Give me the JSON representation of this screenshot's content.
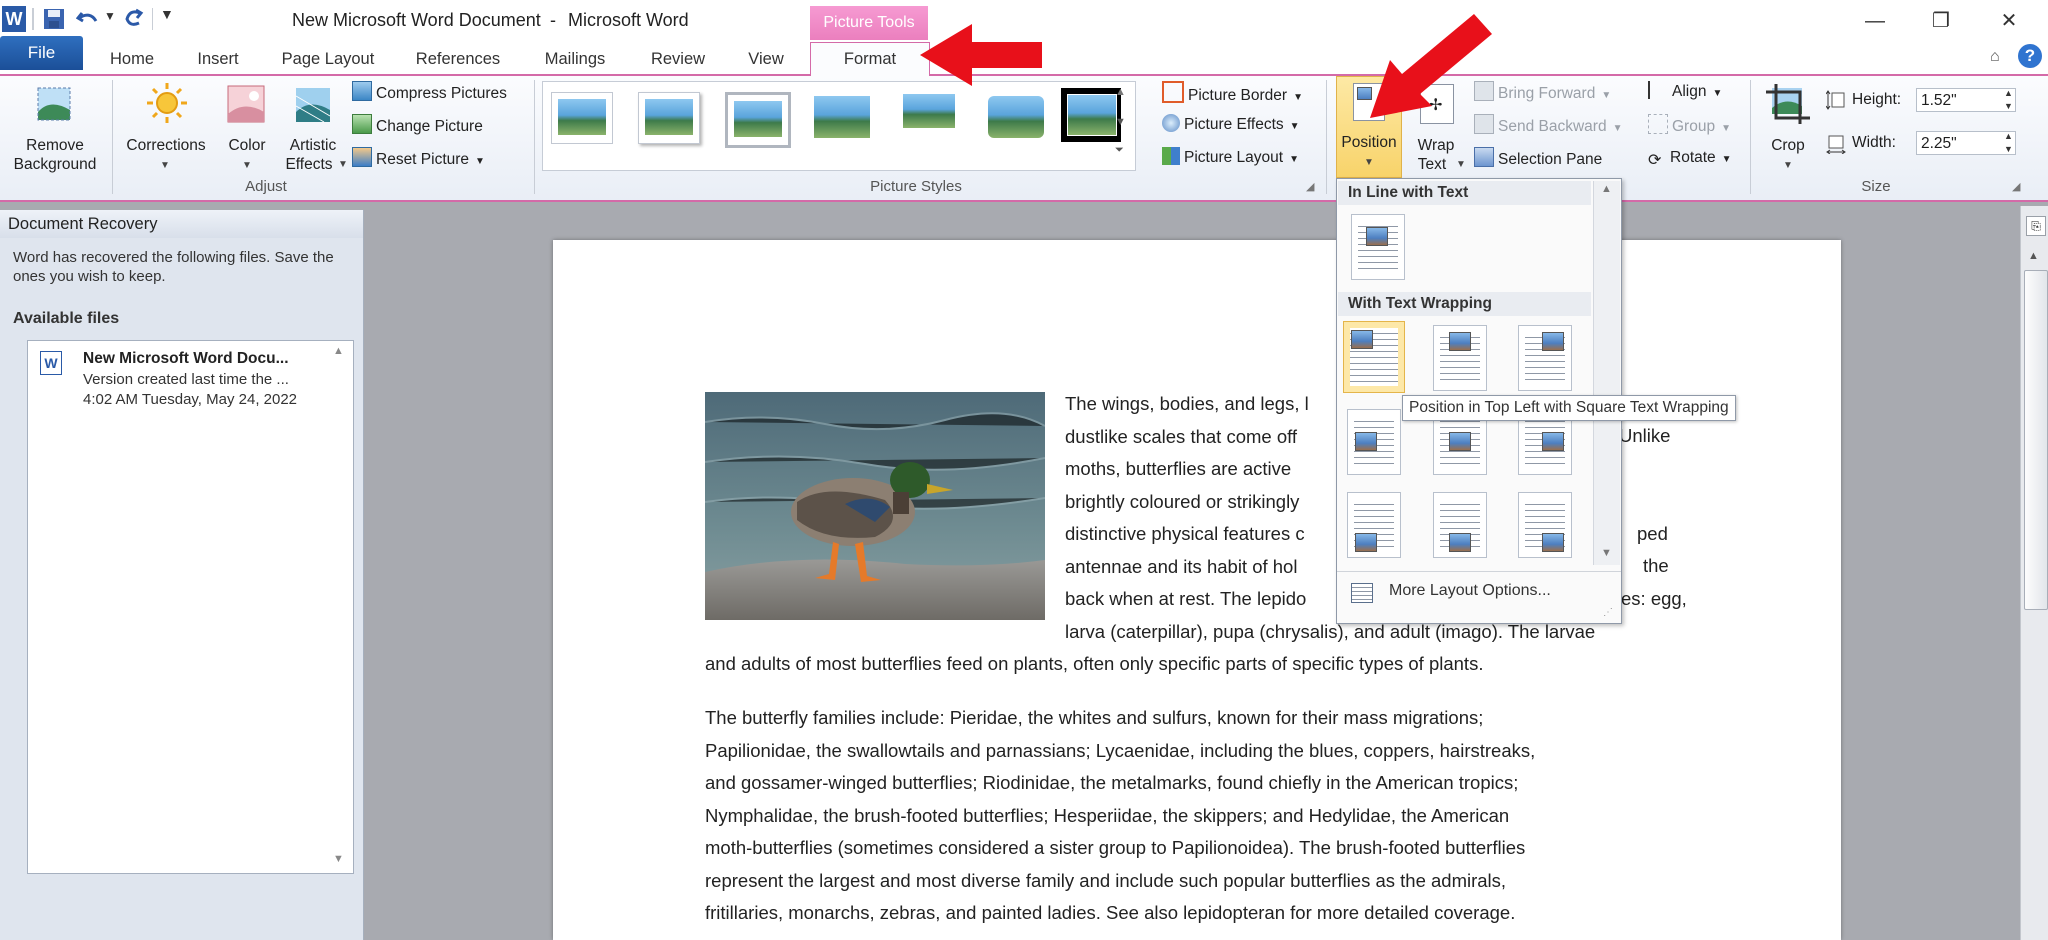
{
  "titlebar": {
    "doc_title": "New Microsoft Word Document",
    "separator": "-",
    "app_name": "Microsoft Word",
    "context_group": "Picture Tools"
  },
  "tabs": [
    "File",
    "Home",
    "Insert",
    "Page Layout",
    "References",
    "Mailings",
    "Review",
    "View",
    "Format"
  ],
  "active_tab": "Format",
  "ribbon": {
    "adjust": {
      "remove_background": [
        "Remove",
        "Background"
      ],
      "corrections": "Corrections",
      "color": "Color",
      "artistic_effects": [
        "Artistic",
        "Effects"
      ],
      "compress": "Compress Pictures",
      "change": "Change Picture",
      "reset": "Reset Picture",
      "group_label": "Adjust"
    },
    "picture_styles": {
      "border": "Picture Border",
      "effects": "Picture Effects",
      "layout": "Picture Layout",
      "group_label": "Picture Styles"
    },
    "arrange": {
      "position": "Position",
      "wrap_text": [
        "Wrap",
        "Text"
      ],
      "bring_forward": "Bring Forward",
      "send_backward": "Send Backward",
      "selection_pane": "Selection Pane",
      "align": "Align",
      "group": "Group",
      "rotate": "Rotate"
    },
    "size": {
      "crop": "Crop",
      "height_label": "Height:",
      "height_value": "1.52\"",
      "width_label": "Width:",
      "width_value": "2.25\"",
      "group_label": "Size"
    }
  },
  "recovery": {
    "title": "Document Recovery",
    "message": "Word has recovered the following files.  Save the ones you wish to keep.",
    "available_label": "Available files",
    "file": {
      "name": "New Microsoft Word Docu...",
      "version": "Version created last time the ...",
      "time": "4:02 AM Tuesday, May 24, 2022"
    }
  },
  "position_menu": {
    "inline_header": "In Line with Text",
    "wrapping_header": "With Text Wrapping",
    "more_options": "More Layout Options...",
    "tooltip": "Position in Top Left with Square Text Wrapping"
  },
  "document": {
    "wrap_lines": [
      "The wings, bodies, and legs, l",
      "dustlike scales that come off",
      "moths, butterflies are active",
      "brightly coloured or strikingly",
      "distinctive physical features c",
      "antennae and its habit of hol",
      "back when at rest. The lepido",
      "larva (caterpillar), pupa (chrysalis), and adult (imago). The larvae"
    ],
    "wrap_right": [
      "",
      "Unlike",
      "",
      "",
      "ped",
      "the",
      "es: egg,"
    ],
    "para1_last": "and adults of most butterflies feed on plants, often only specific parts of specific types of plants.",
    "para2": [
      "The butterfly families include: Pieridae, the whites and sulfurs, known for their mass migrations;",
      "Papilionidae, the swallowtails  and parnassians; Lycaenidae, including the blues, coppers, hairstreaks,",
      "and gossamer-winged butterflies;  Riodinidae, the metalmarks, found chiefly in the American tropics;",
      "Nymphalidae, the brush-footed butterflies; Hesperiidae, the skippers; and Hedylidae, the American",
      "moth-butterflies (sometimes considered a sister group to Papilionoidea).  The brush-footed butterflies",
      "represent the largest and most diverse family and include such popular butterflies as the admirals,",
      "fritillaries,  monarchs, zebras, and painted ladies. See also lepidopteran for more detailed coverage."
    ]
  },
  "colors": {
    "accent_pink": "#d46aa8",
    "file_blue": "#1b4f98",
    "arrow_red": "#e8101a",
    "highlight": "#fde8a8"
  }
}
